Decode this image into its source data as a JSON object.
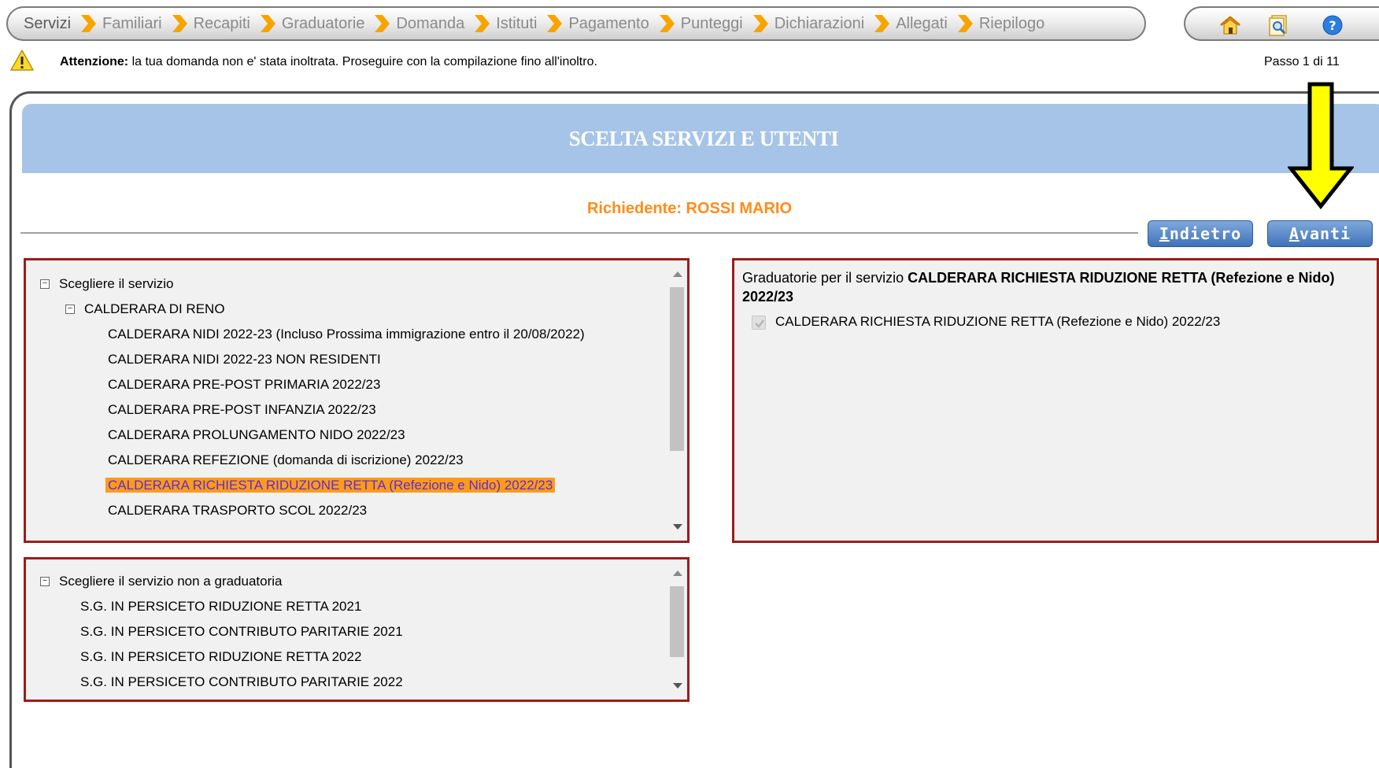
{
  "wizard": {
    "steps": [
      {
        "label": "Servizi"
      },
      {
        "label": "Familiari"
      },
      {
        "label": "Recapiti"
      },
      {
        "label": "Graduatorie"
      },
      {
        "label": "Domanda"
      },
      {
        "label": "Istituti"
      },
      {
        "label": "Pagamento"
      },
      {
        "label": "Punteggi"
      },
      {
        "label": "Dichiarazioni"
      },
      {
        "label": "Allegati"
      },
      {
        "label": "Riepilogo"
      }
    ],
    "arrow_color": "#f7a400"
  },
  "nav_icons": [
    "home-icon",
    "search-document-icon",
    "help-icon"
  ],
  "warning": {
    "title": "Attenzione:",
    "text": "la tua domanda non e' stata inoltrata. Proseguire con la compilazione fino all'inoltro."
  },
  "step_counter": "Passo 1 di 11",
  "page_title": "SCELTA SERVIZI E UTENTI",
  "applicant": "Richiedente: ROSSI MARIO",
  "buttons": {
    "back": "Indietro",
    "next": "Avanti"
  },
  "services_tree": {
    "root_label": "Scegliere il servizio",
    "group_label": "CALDERARA DI RENO",
    "items": [
      "CALDERARA NIDI 2022-23 (Incluso Prossima immigrazione entro il 20/08/2022)",
      "CALDERARA NIDI 2022-23 NON RESIDENTI",
      "CALDERARA PRE-POST PRIMARIA 2022/23",
      "CALDERARA PRE-POST INFANZIA 2022/23",
      "CALDERARA PROLUNGAMENTO NIDO 2022/23",
      "CALDERARA REFEZIONE (domanda di iscrizione) 2022/23",
      "CALDERARA RICHIESTA RIDUZIONE RETTA (Refezione e Nido) 2022/23",
      "CALDERARA TRASPORTO SCOL 2022/23"
    ],
    "selected_index": 6
  },
  "nongrad_tree": {
    "root_label": "Scegliere il servizio non a graduatoria",
    "items": [
      "S.G. IN PERSICETO RIDUZIONE RETTA 2021",
      "S.G. IN PERSICETO CONTRIBUTO PARITARIE 2021",
      "S.G. IN PERSICETO RIDUZIONE RETTA 2022",
      "S.G. IN PERSICETO CONTRIBUTO PARITARIE 2022"
    ]
  },
  "rankings": {
    "heading_prefix": "Graduatorie per il servizio",
    "heading_service": "CALDERARA RICHIESTA RIDUZIONE RETTA (Refezione e Nido) 2022/23",
    "item_label": "CALDERARA RICHIESTA RIDUZIONE RETTA (Refezione e Nido) 2022/23",
    "item_checked": true
  },
  "colors": {
    "title_band": "#a6c4e7",
    "applicant": "#ff8c1a",
    "panel_border": "#9c1c1c",
    "selected_bg": "#ff9a1a",
    "hint_arrow": "#ffff00"
  }
}
